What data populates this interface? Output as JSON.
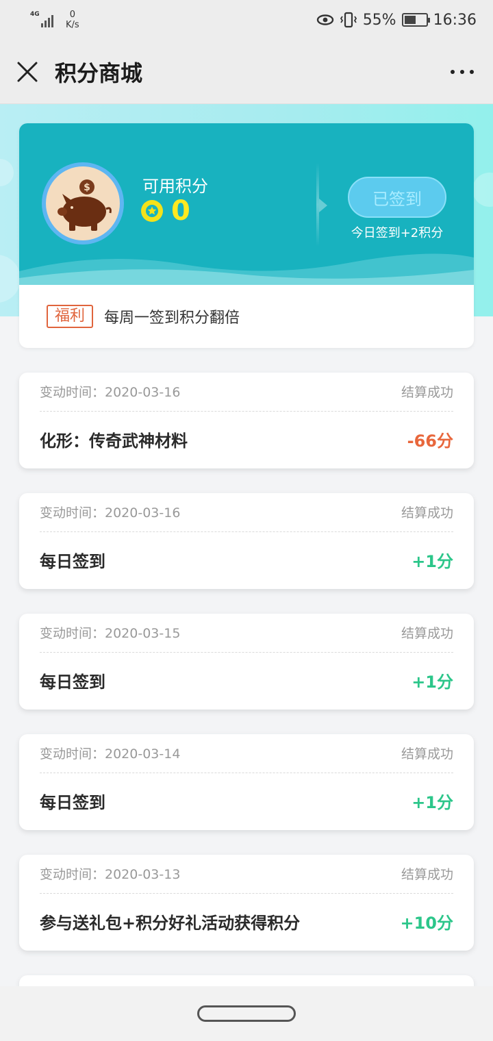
{
  "status_bar": {
    "network": "4G",
    "speed_value": "0",
    "speed_unit": "K/s",
    "battery": "55%",
    "battery_level": 0.55,
    "time": "16:36"
  },
  "nav": {
    "title": "积分商城"
  },
  "points_card": {
    "available_label": "可用积分",
    "points": "0",
    "signed_button_label": "已签到",
    "sign_hint": "今日签到+2积分",
    "welfare_tag": "福利",
    "welfare_text": "每周一签到积分翻倍"
  },
  "records": [
    {
      "time_label": "变动时间：2020-03-16",
      "status": "结算成功",
      "title": "化形：传奇武神材料",
      "change": "-66分",
      "sign": "neg"
    },
    {
      "time_label": "变动时间：2020-03-16",
      "status": "结算成功",
      "title": "每日签到",
      "change": "+1分",
      "sign": "pos"
    },
    {
      "time_label": "变动时间：2020-03-15",
      "status": "结算成功",
      "title": "每日签到",
      "change": "+1分",
      "sign": "pos"
    },
    {
      "time_label": "变动时间：2020-03-14",
      "status": "结算成功",
      "title": "每日签到",
      "change": "+1分",
      "sign": "pos"
    },
    {
      "time_label": "变动时间：2020-03-13",
      "status": "结算成功",
      "title": "参与送礼包+积分好礼活动获得积分",
      "change": "+10分",
      "sign": "pos"
    }
  ],
  "colors": {
    "accent": "#18b2bf",
    "negative": "#e8673c",
    "positive": "#2cc68a",
    "points_yellow": "#ffe920"
  }
}
